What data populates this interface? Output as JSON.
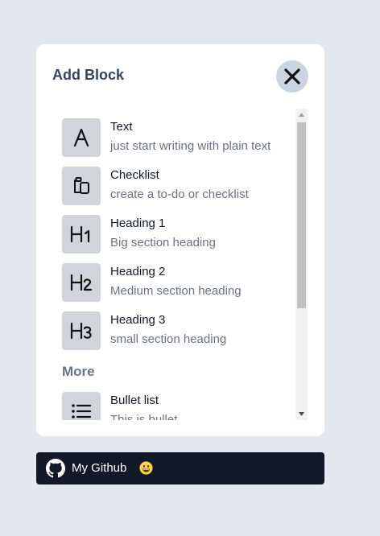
{
  "panel": {
    "title": "Add Block",
    "close_icon": "close-icon"
  },
  "blocks": [
    {
      "icon": "letter-a-icon",
      "title": "Text",
      "subtitle": "just start writing with plain text"
    },
    {
      "icon": "clipboard-icon",
      "title": "Checklist",
      "subtitle": "create a to-do or checklist"
    },
    {
      "icon": "heading-1-icon",
      "title": "Heading 1",
      "subtitle": "Big section heading"
    },
    {
      "icon": "heading-2-icon",
      "title": "Heading 2",
      "subtitle": "Medium section heading"
    },
    {
      "icon": "heading-3-icon",
      "title": "Heading 3",
      "subtitle": "small section heading"
    }
  ],
  "more": {
    "label": "More",
    "items": [
      {
        "icon": "bullet-list-icon",
        "title": "Bullet list",
        "subtitle": "This is bullet"
      }
    ]
  },
  "footer": {
    "github_label": "My Github",
    "github_icon": "github-icon",
    "emoji_icon": "grinning-face-emoji"
  },
  "colors": {
    "background": "#e2e8f0",
    "panel": "#ffffff",
    "icon_tile": "#d1d5db",
    "close_button": "#cbd5e1",
    "github_button": "#111827",
    "title_text": "#3b4455",
    "muted_text": "#6b7280"
  }
}
